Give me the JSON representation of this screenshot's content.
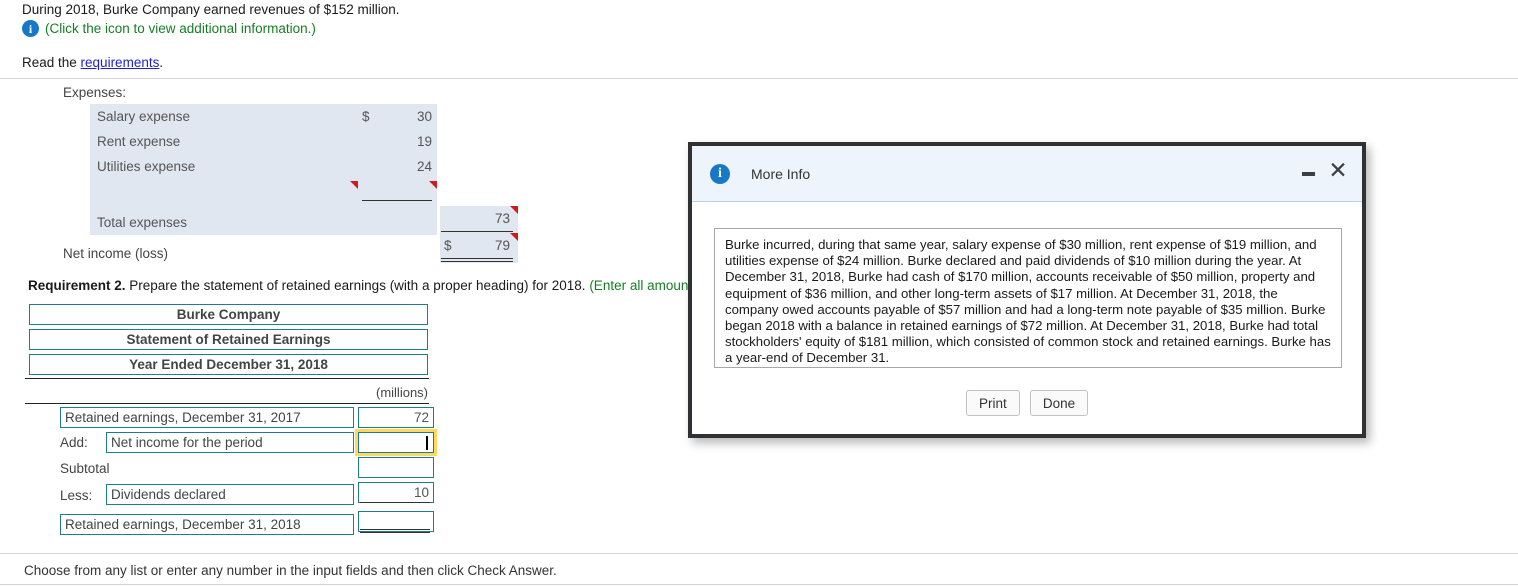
{
  "problem": {
    "line1": "During 2018, Burke Company earned revenues of $152 million.",
    "icon_note": "(Click the icon to view additional information.)",
    "read_prefix": "Read the ",
    "read_link": "requirements",
    "read_suffix": "."
  },
  "income_statement": {
    "expenses_header": "Expenses:",
    "rows": [
      {
        "label": "Salary expense",
        "dollar": "$",
        "amount": "30"
      },
      {
        "label": "Rent expense",
        "dollar": "",
        "amount": "19"
      },
      {
        "label": "Utilities expense",
        "dollar": "",
        "amount": "24"
      }
    ],
    "total_label": "Total expenses",
    "total_amount": "73",
    "net_income_label": "Net income (loss)",
    "net_income_dollar": "$",
    "net_income_amount": "79"
  },
  "requirement2": {
    "number": "Requirement 2.",
    "text": " Prepare the statement of retained earnings (with a proper heading) for 2018. ",
    "green_note": "(Enter all amounts in",
    "headings": [
      "Burke Company",
      "Statement of Retained Earnings",
      "Year Ended December 31, 2018"
    ],
    "units_label": "(millions)",
    "lines": [
      {
        "prefix": "",
        "label": "Retained earnings, December 31, 2017",
        "value": "72",
        "focused": false
      },
      {
        "prefix": "Add:",
        "label": "Net income for the period",
        "value": "",
        "focused": true
      },
      {
        "prefix": "",
        "label": "Subtotal",
        "value": "",
        "focused": false
      },
      {
        "prefix": "Less:",
        "label": "Dividends declared",
        "value": "10",
        "focused": false
      },
      {
        "prefix": "",
        "label": "Retained earnings, December 31, 2018",
        "value": "",
        "focused": false
      }
    ]
  },
  "bottom_note": "Choose from any list or enter any number in the input fields and then click Check Answer.",
  "dialog": {
    "title": "More Info",
    "body": "Burke incurred, during that same year, salary expense of $30 million, rent expense of $19 million, and utilities expense of $24 million. Burke declared and paid dividends of $10 million during the year. At December 31, 2018, Burke had cash of $170 million, accounts receivable of $50 million, property and equipment of $36 million, and other long-term assets of $17 million. At December 31, 2018, the company owed accounts payable of $57 million and had a long-term note payable of $35 million. Burke began 2018 with a balance in retained earnings of $72 million. At December 31, 2018, Burke had total stockholders' equity of $181 million, which consisted of common stock and retained earnings. Burke has a year-end of December 31.",
    "print_label": "Print",
    "done_label": "Done",
    "minimize_label": "–",
    "close_label": "✕"
  },
  "colors": {
    "accent_teal": "#1d7d8c",
    "focus_yellow": "#ffd95e",
    "shade_blue": "#e1e7f0",
    "marker_red": "#d01b1b",
    "info_blue": "#1878c8",
    "green": "#167f23"
  }
}
